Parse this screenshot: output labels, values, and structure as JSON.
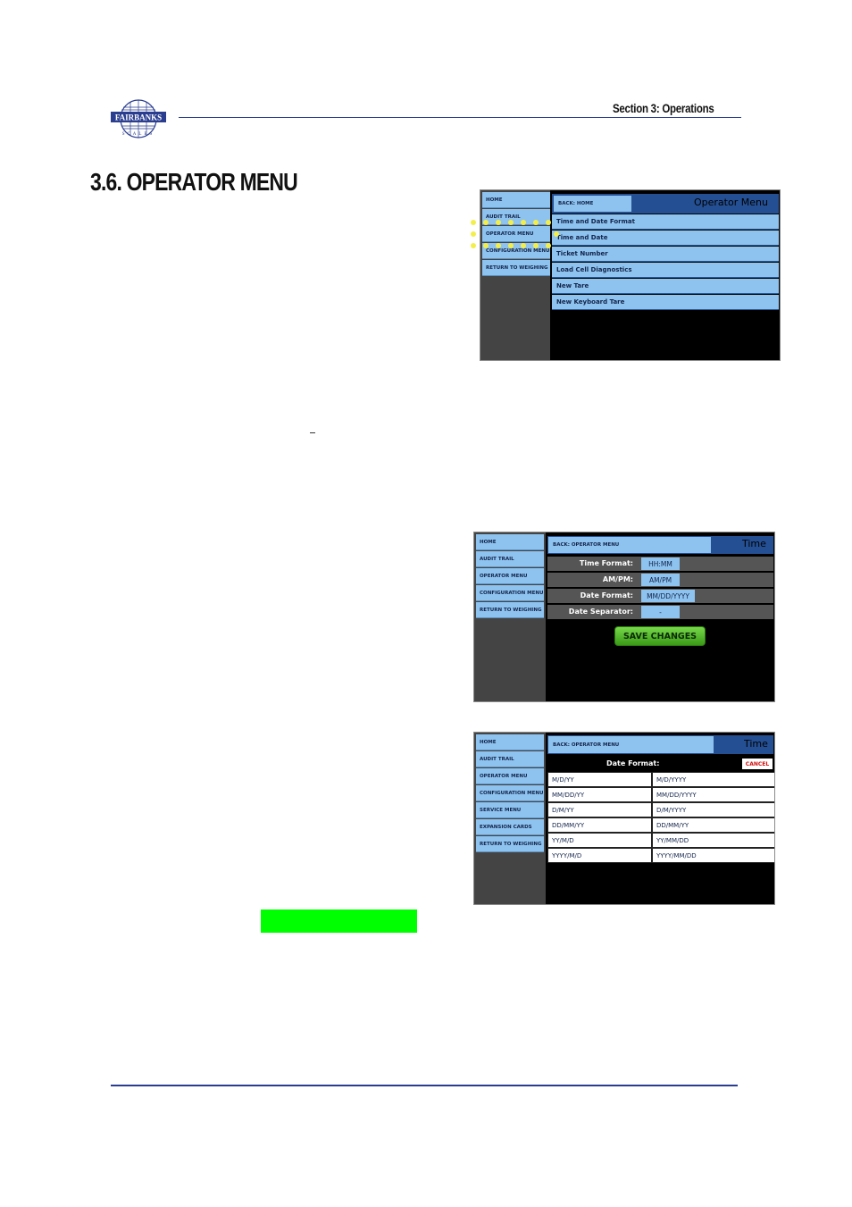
{
  "header": {
    "section_label": "Section 3:  Operations",
    "page_heading": "3.6.  OPERATOR MENU",
    "logo_text": "FAIRBANKS SCALES"
  },
  "screen1": {
    "sidebar": [
      "HOME",
      "AUDIT TRAIL",
      "OPERATOR MENU",
      "CONFIGURATION MENU",
      "RETURN TO WEIGHING"
    ],
    "back_label": "BACK: HOME",
    "title": "Operator Menu",
    "menu_items": [
      "Time and Date Format",
      "Time and Date",
      "Ticket Number",
      "Load Cell Diagnostics",
      "New Tare",
      "New Keyboard Tare"
    ]
  },
  "screen2": {
    "sidebar": [
      "HOME",
      "AUDIT TRAIL",
      "OPERATOR MENU",
      "CONFIGURATION MENU",
      "RETURN TO WEIGHING"
    ],
    "back_label": "BACK: OPERATOR MENU",
    "title": "Time",
    "fields": [
      {
        "label": "Time Format:",
        "value": "HH:MM"
      },
      {
        "label": "AM/PM:",
        "value": "AM/PM"
      },
      {
        "label": "Date Format:",
        "value": "MM/DD/YYYY"
      },
      {
        "label": "Date Separator:",
        "value": "-"
      }
    ],
    "save_label": "SAVE CHANGES"
  },
  "screen3": {
    "sidebar": [
      "HOME",
      "AUDIT TRAIL",
      "OPERATOR MENU",
      "CONFIGURATION MENU",
      "SERVICE MENU",
      "EXPANSION CARDS",
      "RETURN TO WEIGHING"
    ],
    "back_label": "BACK: OPERATOR MENU",
    "title": "Time",
    "picker_label": "Date Format:",
    "cancel_label": "CANCEL",
    "options": [
      [
        "M/D/YY",
        "M/D/YYYY"
      ],
      [
        "MM/DD/YY",
        "MM/DD/YYYY"
      ],
      [
        "D/M/YY",
        "D/M/YYYY"
      ],
      [
        "DD/MM/YY",
        "DD/MM/YY"
      ],
      [
        "YY/M/D",
        "YY/MM/DD"
      ],
      [
        "YYYY/M/D",
        "YYYY/MM/DD"
      ]
    ]
  },
  "colors": {
    "accent_blue": "#244f93",
    "button_blue": "#8ec3ef",
    "highlight_green": "#00ff00",
    "rule_blue": "#2a3d8f",
    "callout_yellow": "#f3ef4a"
  }
}
